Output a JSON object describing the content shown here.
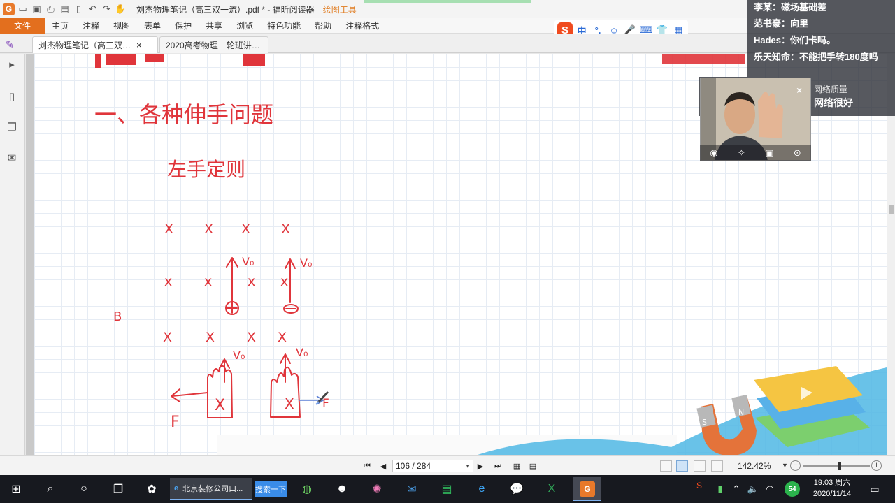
{
  "titlebar": {
    "document_title": "刘杰物理笔记（高三双一流）.pdf * - 福昕阅读器",
    "context_tab": "绘图工具",
    "quick_access_icons": [
      "app-logo",
      "open-icon",
      "save-icon",
      "print-icon",
      "scan-icon",
      "new-icon",
      "undo-icon",
      "redo-icon",
      "hand-tool-icon"
    ]
  },
  "ribbon": {
    "file_menu": "文件",
    "tabs": [
      "主页",
      "注释",
      "视图",
      "表单",
      "保护",
      "共享",
      "浏览",
      "特色功能",
      "帮助",
      "注释格式"
    ]
  },
  "ime": {
    "logo": "S",
    "items": [
      "中",
      "°,",
      "☺",
      "🎤",
      "⌨",
      "👕",
      "▦"
    ]
  },
  "doc_tabs": [
    {
      "label": "刘杰物理笔记（高三双…",
      "close": "×"
    },
    {
      "label": "2020高考物理一轮班讲…",
      "close": ""
    }
  ],
  "note": {
    "heading": "一、各种伸手问题",
    "subheading": "左手定则",
    "field_label": "B",
    "row1_marks": [
      "X",
      "X",
      "X",
      "X"
    ],
    "row2_marks": [
      "x",
      "x",
      "x",
      "x"
    ],
    "row3_marks": [
      "X",
      "X",
      "X",
      "X"
    ],
    "velocity_label": "V₀",
    "velocity_label_lower": "V₀",
    "force_label": "F",
    "palm_mark": "X"
  },
  "chat": {
    "messages": [
      "李某：磁场基础差",
      "范书豪：向里",
      "Hades：你们卡吗。",
      "乐天知命：不能把手转180度吗"
    ]
  },
  "webcam": {
    "close": "×",
    "network_quality_label": "网络质量",
    "network_quality_value": "网络很好"
  },
  "statusbar": {
    "page_display": "106 / 284",
    "zoom_level": "142.42%",
    "zoom_fraction": 0.54
  },
  "taskbar": {
    "browser_task_label": "北京装修公司口...",
    "search_button": "搜索一下",
    "net_badge": "54",
    "time": "19:03 周六",
    "date": "2020/11/14"
  },
  "colors": {
    "ink": "#e0353b",
    "file_menu": "#e36f1e",
    "context_tab": "#e07b1f",
    "grid": "#e6ecf4"
  }
}
